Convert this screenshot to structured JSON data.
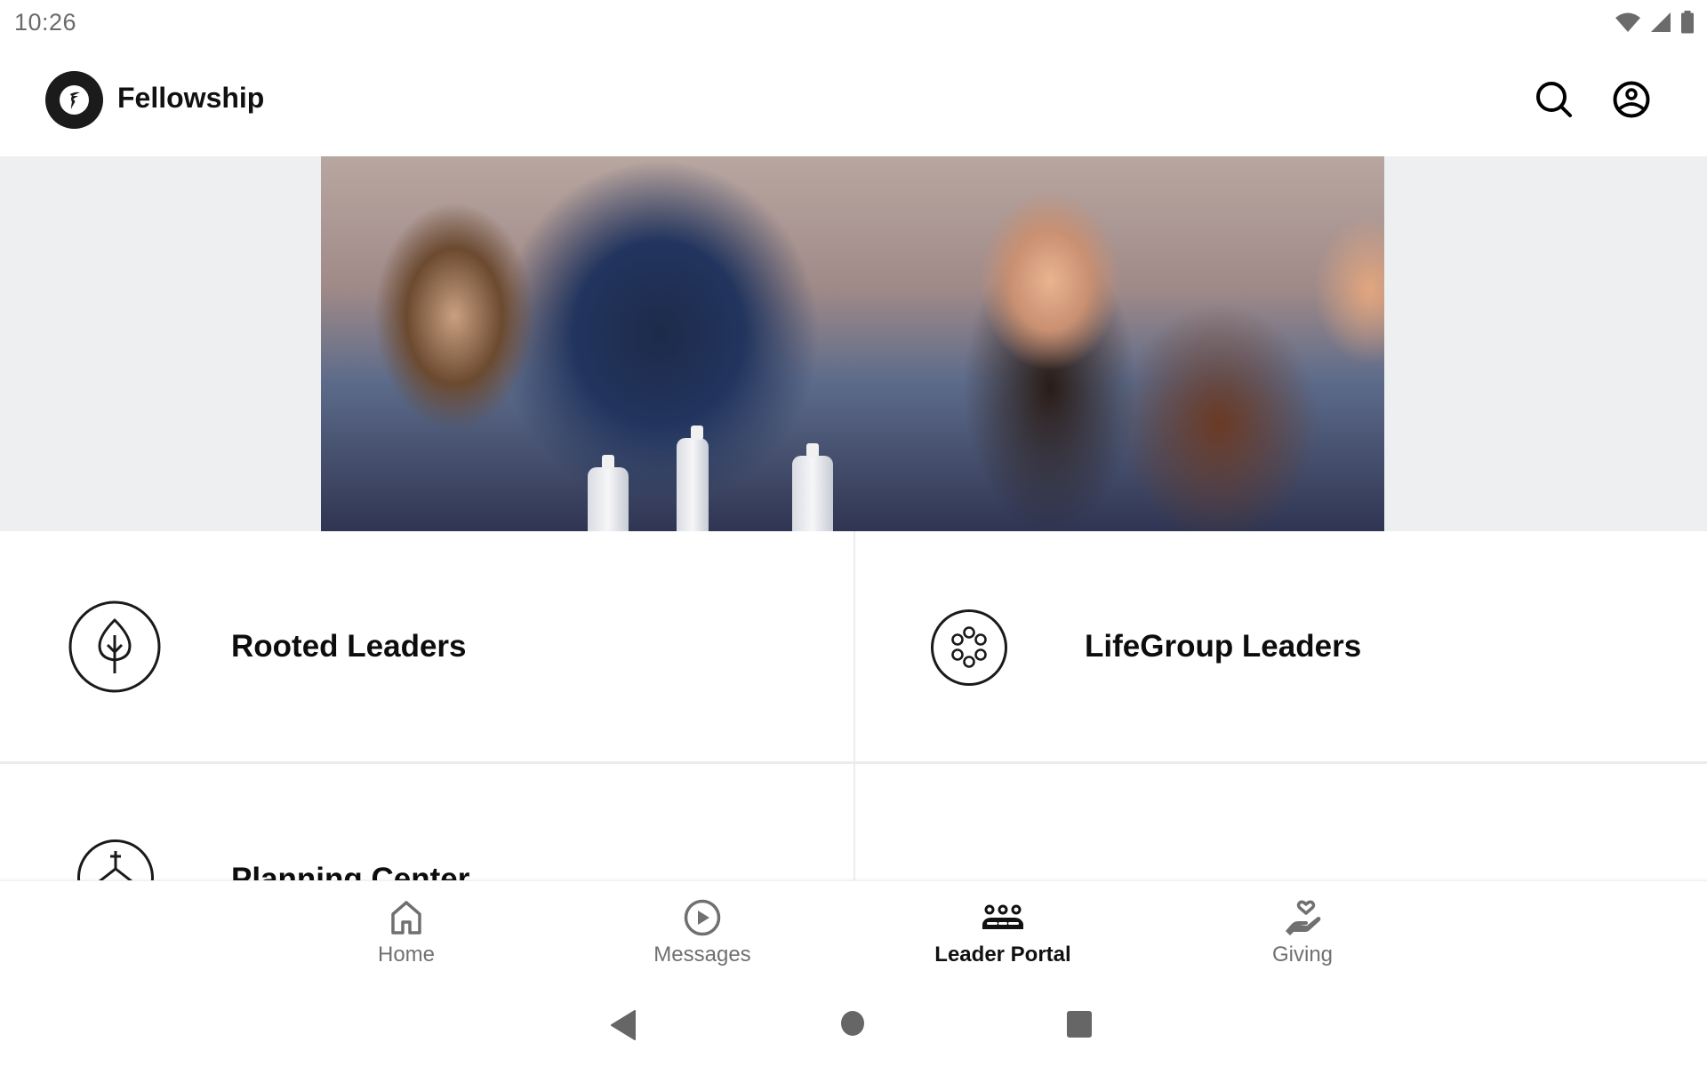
{
  "status_bar": {
    "time": "10:26",
    "icons": [
      "wifi-icon",
      "cell-signal-icon",
      "battery-icon"
    ]
  },
  "header": {
    "app_name": "Fellowship",
    "logo_icon": "fellowship-logo-icon",
    "actions": [
      {
        "name": "search",
        "icon": "search-icon"
      },
      {
        "name": "profile",
        "icon": "account-circle-icon"
      }
    ]
  },
  "banner": {
    "description": "Group of people laughing around a table with water bottles at night"
  },
  "tiles": [
    {
      "label": "Rooted Leaders",
      "icon": "leaf-icon"
    },
    {
      "label": "LifeGroup Leaders",
      "icon": "circle-of-dots-icon"
    },
    {
      "label": "Planning Center",
      "icon": "church-steeple-icon"
    }
  ],
  "bottom_nav": {
    "items": [
      {
        "label": "Home",
        "icon": "home-icon",
        "active": false
      },
      {
        "label": "Messages",
        "icon": "play-circle-icon",
        "active": false
      },
      {
        "label": "Leader Portal",
        "icon": "group-icon",
        "active": true
      },
      {
        "label": "Giving",
        "icon": "hand-heart-icon",
        "active": false
      }
    ]
  },
  "system_nav": {
    "buttons": [
      "back",
      "home",
      "recents"
    ]
  },
  "colors": {
    "text_primary": "#111111",
    "nav_inactive": "#707070",
    "banner_background": "#eeeff1",
    "divider": "#ececec",
    "system_icons": "#666666"
  }
}
